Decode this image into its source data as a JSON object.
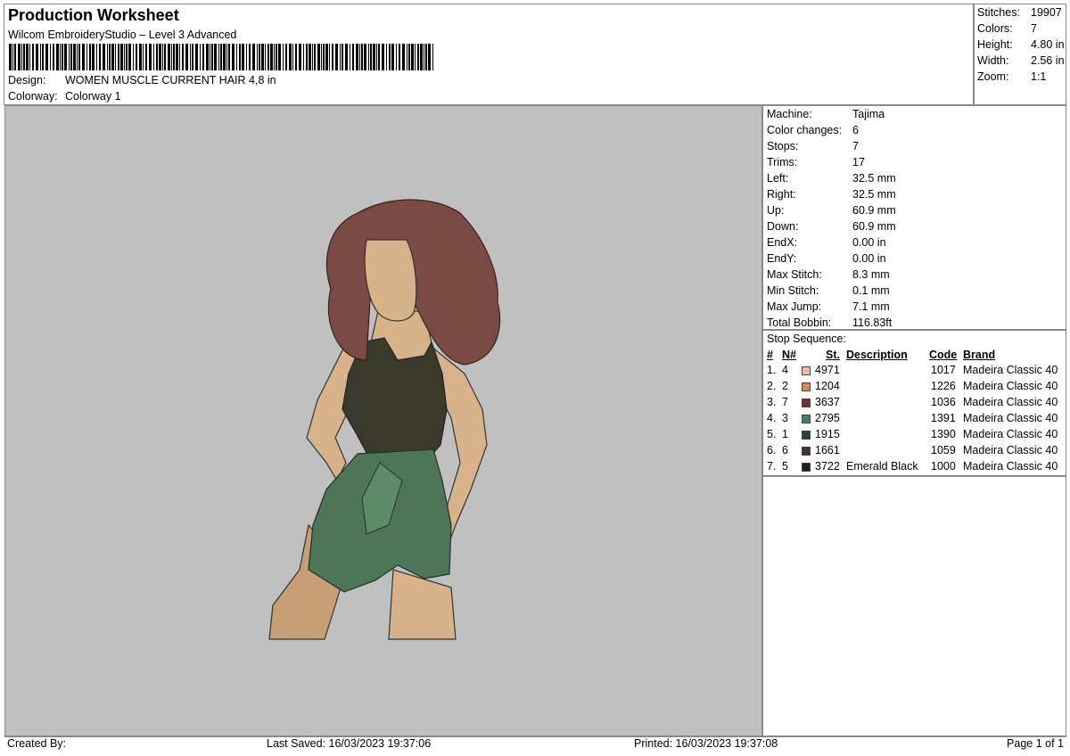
{
  "header": {
    "title": "Production Worksheet",
    "subtitle": "Wilcom EmbroideryStudio – Level 3 Advanced",
    "design_label": "Design:",
    "design_value": "WOMEN MUSCLE CURRENT HAIR 4,8 in",
    "colorway_label": "Colorway:",
    "colorway_value": "Colorway 1"
  },
  "summary": [
    {
      "label": "Stitches:",
      "value": "19907"
    },
    {
      "label": "Colors:",
      "value": "7"
    },
    {
      "label": "Height:",
      "value": "4.80 in"
    },
    {
      "label": "Width:",
      "value": "2.56 in"
    },
    {
      "label": "Zoom:",
      "value": "1:1"
    }
  ],
  "machine_info": [
    {
      "label": "Machine:",
      "value": "Tajima"
    },
    {
      "label": "Color changes:",
      "value": "6"
    },
    {
      "label": "Stops:",
      "value": "7"
    },
    {
      "label": "Trims:",
      "value": "17"
    },
    {
      "label": "Left:",
      "value": "32.5 mm"
    },
    {
      "label": "Right:",
      "value": "32.5 mm"
    },
    {
      "label": "Up:",
      "value": "60.9 mm"
    },
    {
      "label": "Down:",
      "value": "60.9 mm"
    },
    {
      "label": "EndX:",
      "value": "0.00 in"
    },
    {
      "label": "EndY:",
      "value": "0.00 in"
    },
    {
      "label": "Max Stitch:",
      "value": "8.3 mm"
    },
    {
      "label": "Min Stitch:",
      "value": "0.1 mm"
    },
    {
      "label": "Max Jump:",
      "value": "7.1 mm"
    },
    {
      "label": "Total Bobbin:",
      "value": "116.83ft"
    }
  ],
  "stops": {
    "title": "Stop Sequence:",
    "headers": {
      "num": "#",
      "n": "N#",
      "st": "St.",
      "description": "Description",
      "code": "Code",
      "brand": "Brand"
    },
    "rows": [
      {
        "num": "1.",
        "n": "4",
        "color": "#f2b8a8",
        "st": "4971",
        "description": "",
        "code": "1017",
        "brand": "Madeira Classic 40"
      },
      {
        "num": "2.",
        "n": "2",
        "color": "#cf8a5c",
        "st": "1204",
        "description": "",
        "code": "1226",
        "brand": "Madeira Classic 40"
      },
      {
        "num": "3.",
        "n": "7",
        "color": "#6b2f35",
        "st": "3637",
        "description": "",
        "code": "1036",
        "brand": "Madeira Classic 40"
      },
      {
        "num": "4.",
        "n": "3",
        "color": "#4f7a66",
        "st": "2795",
        "description": "",
        "code": "1391",
        "brand": "Madeira Classic 40"
      },
      {
        "num": "5.",
        "n": "1",
        "color": "#234536",
        "st": "1915",
        "description": "",
        "code": "1390",
        "brand": "Madeira Classic 40"
      },
      {
        "num": "6.",
        "n": "6",
        "color": "#3f3232",
        "st": "1661",
        "description": "",
        "code": "1059",
        "brand": "Madeira Classic 40"
      },
      {
        "num": "7.",
        "n": "5",
        "color": "#1e1e1e",
        "st": "3722",
        "description": "Emerald Black",
        "code": "1000",
        "brand": "Madeira Classic 40"
      }
    ]
  },
  "footer": {
    "created_by": "Created By:",
    "last_saved": "Last Saved: 16/03/2023 19:37:06",
    "printed": "Printed: 16/03/2023 19:37:08",
    "page": "Page 1 of 1"
  },
  "colors": {
    "preview_bg": "#c0c0c0",
    "hair": "#7a4a44",
    "skin": "#d7b28a",
    "tank": "#3a3a2c",
    "shorts": "#4e7558"
  }
}
